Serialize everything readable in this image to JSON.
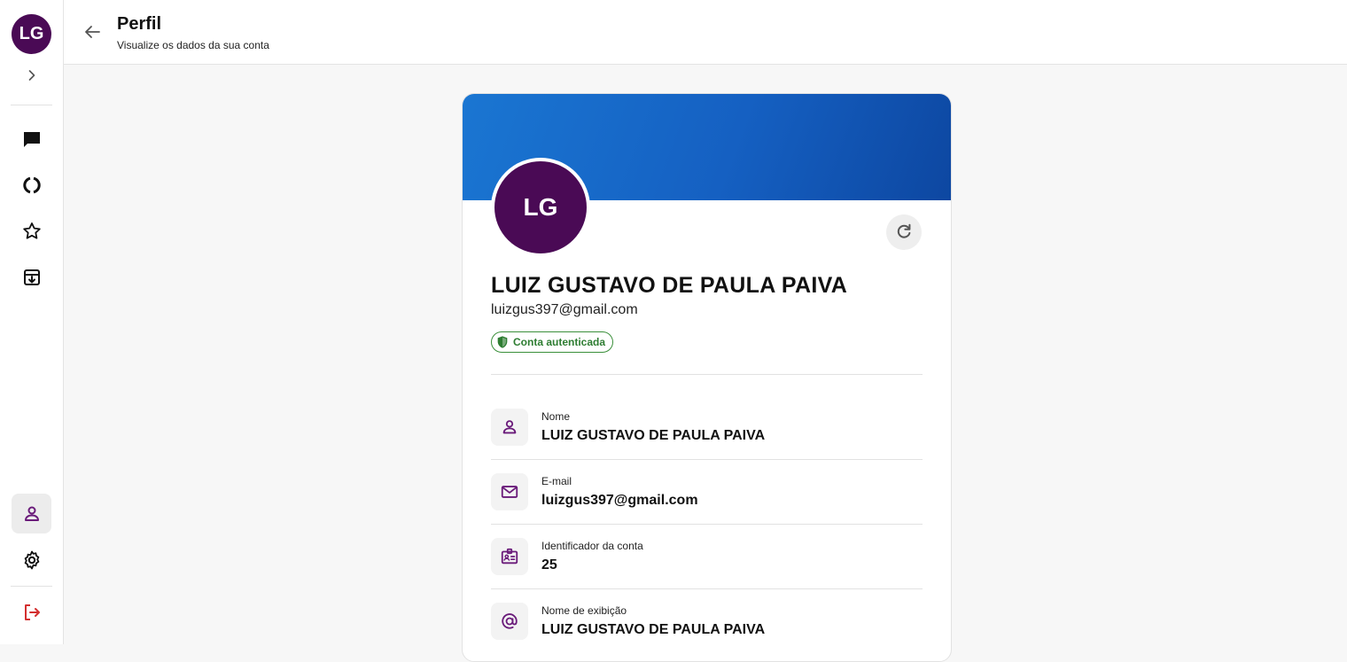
{
  "sidebar": {
    "avatar_initials": "LG",
    "nav": [
      {
        "icon": "chat-icon"
      },
      {
        "icon": "loading-ring-icon"
      },
      {
        "icon": "star-icon"
      },
      {
        "icon": "archive-icon"
      }
    ],
    "bottom": [
      {
        "icon": "person-icon",
        "active": true
      },
      {
        "icon": "gear-icon"
      },
      {
        "icon": "logout-icon"
      }
    ]
  },
  "header": {
    "title": "Perfil",
    "subtitle": "Visualize os dados da sua conta"
  },
  "profile": {
    "initials": "LG",
    "name": "LUIZ GUSTAVO DE PAULA PAIVA",
    "email": "luizgus397@gmail.com",
    "badge": "Conta autenticada",
    "fields": [
      {
        "label": "Nome",
        "value": "LUIZ GUSTAVO DE PAULA PAIVA",
        "icon": "person-icon"
      },
      {
        "label": "E-mail",
        "value": "luizgus397@gmail.com",
        "icon": "mail-icon"
      },
      {
        "label": "Identificador da conta",
        "value": "25",
        "icon": "id-badge-icon"
      },
      {
        "label": "Nome de exibição",
        "value": "LUIZ GUSTAVO DE PAULA PAIVA",
        "icon": "at-sign-icon"
      }
    ]
  },
  "colors": {
    "avatar": "#4a0a55",
    "accent_purple": "#6a1b7a",
    "banner_start": "#1a76d2",
    "banner_end": "#0d47a1",
    "badge_green": "#2e7d32",
    "logout_red": "#d32f2f"
  }
}
